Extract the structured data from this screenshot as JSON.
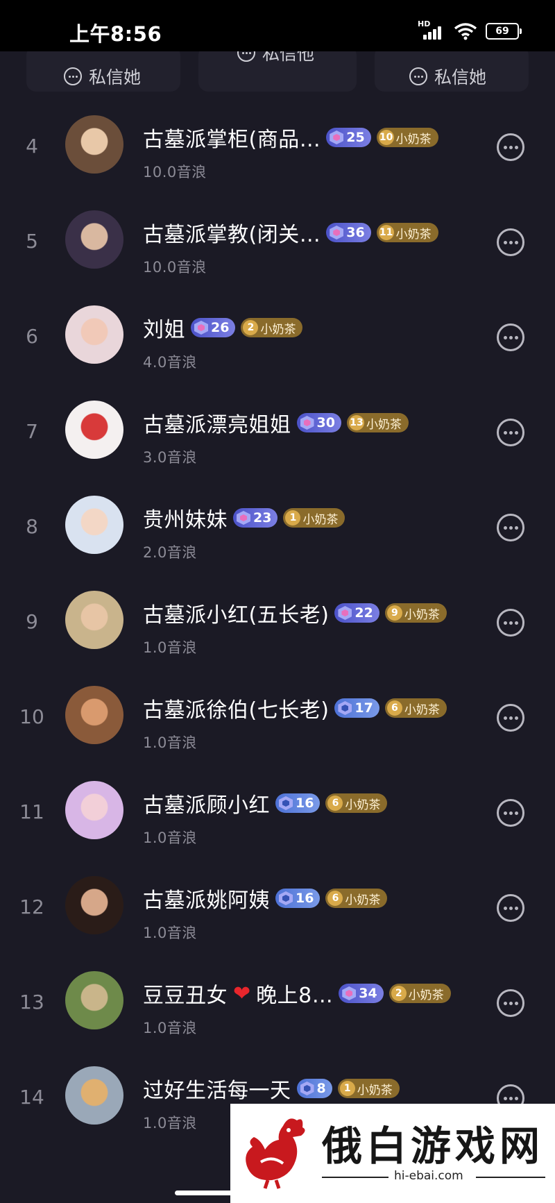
{
  "status_bar": {
    "time": "上午8:56",
    "battery": "69",
    "network": "HD"
  },
  "top_cards": {
    "left_label": "私信她",
    "center_label": "私信他",
    "right_label": "私信她"
  },
  "rows": [
    {
      "rank": "4",
      "name": "古墓派掌柜(商品…",
      "level": "25",
      "fan_level": "10",
      "fan_label": "小奶茶",
      "score": "10.0音浪",
      "level_style": "purple"
    },
    {
      "rank": "5",
      "name": "古墓派掌教(闭关…",
      "level": "36",
      "fan_level": "11",
      "fan_label": "小奶茶",
      "score": "10.0音浪",
      "level_style": "purple"
    },
    {
      "rank": "6",
      "name": "刘姐",
      "level": "26",
      "fan_level": "2",
      "fan_label": "小奶茶",
      "score": "4.0音浪",
      "level_style": "purple"
    },
    {
      "rank": "7",
      "name": "古墓派漂亮姐姐",
      "level": "30",
      "fan_level": "13",
      "fan_label": "小奶茶",
      "score": "3.0音浪",
      "level_style": "purple"
    },
    {
      "rank": "8",
      "name": "贵州妹妹",
      "level": "23",
      "fan_level": "1",
      "fan_label": "小奶茶",
      "score": "2.0音浪",
      "level_style": "purple"
    },
    {
      "rank": "9",
      "name": "古墓派小红(五长老)",
      "level": "22",
      "fan_level": "9",
      "fan_label": "小奶茶",
      "score": "1.0音浪",
      "level_style": "purple"
    },
    {
      "rank": "10",
      "name": "古墓派徐伯(七长老)",
      "level": "17",
      "fan_level": "6",
      "fan_label": "小奶茶",
      "score": "1.0音浪",
      "level_style": "blue"
    },
    {
      "rank": "11",
      "name": "古墓派顾小红",
      "level": "16",
      "fan_level": "6",
      "fan_label": "小奶茶",
      "score": "1.0音浪",
      "level_style": "blue"
    },
    {
      "rank": "12",
      "name": "古墓派姚阿姨",
      "level": "16",
      "fan_level": "6",
      "fan_label": "小奶茶",
      "score": "1.0音浪",
      "level_style": "blue"
    },
    {
      "rank": "13",
      "name": "豆豆丑女",
      "name_suffix": "晚上8…",
      "level": "34",
      "fan_level": "2",
      "fan_label": "小奶茶",
      "score": "1.0音浪",
      "level_style": "purple"
    },
    {
      "rank": "14",
      "name": "过好生活每一天",
      "level": "8",
      "fan_level": "1",
      "fan_label": "小奶茶",
      "score": "1.0音浪",
      "level_style": "blue"
    }
  ],
  "watermark": {
    "title": "俄白游戏网",
    "url": "hi-ebai.com"
  },
  "colors": {
    "background": "#1b1a25",
    "level_purple": "#5a5fd6",
    "fan_gold": "#8a6b2b",
    "muted_text": "#8d8c97"
  }
}
